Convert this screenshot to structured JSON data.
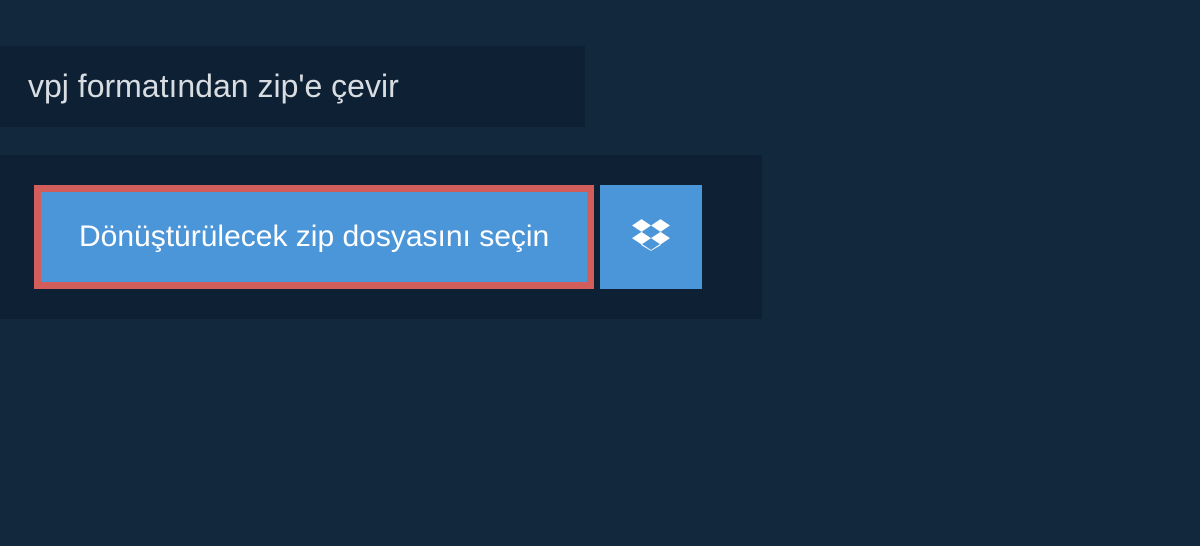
{
  "header": {
    "title": "vpj formatından zip'e çevir"
  },
  "actions": {
    "select_file_label": "Dönüştürülecek zip dosyasını seçin",
    "dropbox_icon": "dropbox-icon"
  },
  "colors": {
    "page_bg": "#12283d",
    "panel_bg": "#0e2033",
    "button_bg": "#4b95d9",
    "highlight_border": "#d25e5b",
    "text_light": "#d8dde2",
    "text_white": "#ffffff"
  }
}
